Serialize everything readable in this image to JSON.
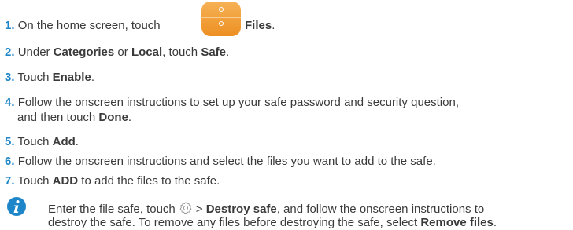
{
  "steps": [
    {
      "num": "1.",
      "pre": "On the home screen, touch",
      "b1": "Files",
      "post": "."
    },
    {
      "num": "2.",
      "pre": "Under ",
      "b1": "Categories",
      "mid": " or ",
      "b2": "Local",
      "mid2": ", touch ",
      "b3": "Safe",
      "post": "."
    },
    {
      "num": "3.",
      "pre": "Touch ",
      "b1": "Enable",
      "post": "."
    },
    {
      "num": "4.",
      "pre": "Follow the onscreen instructions to set up your safe password and security question,",
      "line2_pre": "and then touch ",
      "b1": "Done",
      "post": "."
    },
    {
      "num": "5.",
      "pre": "Touch ",
      "b1": "Add",
      "post": "."
    },
    {
      "num": "6.",
      "pre": "Follow the onscreen instructions and select the files you want to add to the safe."
    },
    {
      "num": "7.",
      "pre": "Touch ",
      "b1": "ADD",
      "post": " to add the files to the safe."
    }
  ],
  "note": {
    "icon": "info-icon",
    "pre": "Enter the file safe, touch",
    "arrow": "> ",
    "b1": "Destroy safe",
    "mid": ", and follow the onscreen instructions to",
    "line2_pre": "destroy the safe. To remove any files before destroying the safe, select ",
    "b2": "Remove files",
    "post": "."
  },
  "colors": {
    "accent": "#1d86c8",
    "app_icon": "#f0a13a"
  }
}
